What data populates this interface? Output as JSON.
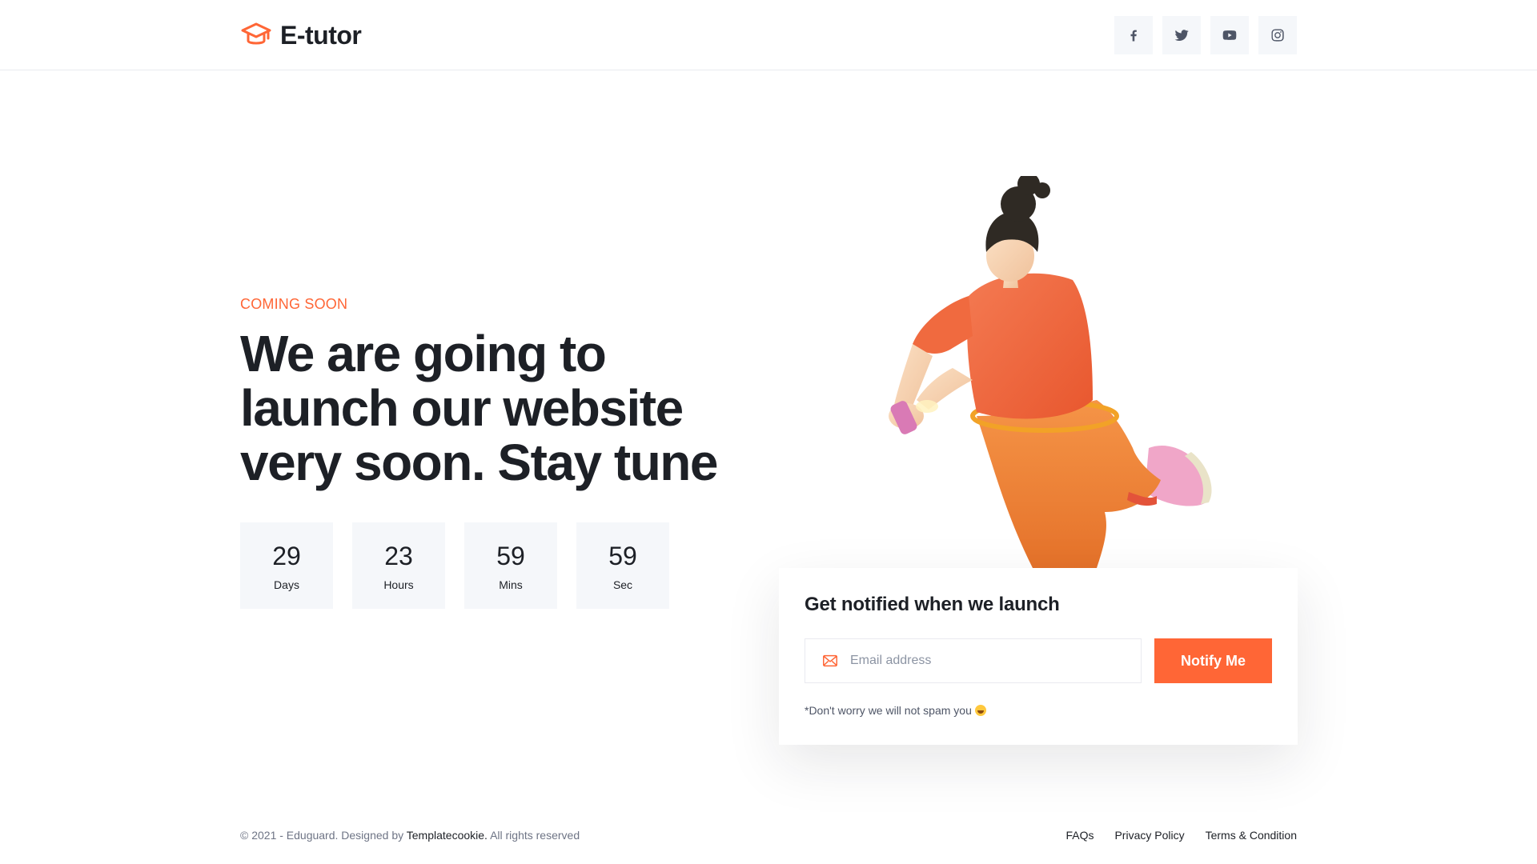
{
  "brand": {
    "name": "E-tutor",
    "accent": "#ff6636"
  },
  "header": {
    "socials": [
      {
        "name": "facebook-icon"
      },
      {
        "name": "twitter-icon"
      },
      {
        "name": "youtube-icon"
      },
      {
        "name": "instagram-icon"
      }
    ]
  },
  "hero": {
    "eyebrow": "COMING SOON",
    "headline": [
      "We are going to",
      "launch our website",
      "very soon. Stay tune"
    ]
  },
  "countdown": [
    {
      "value": "29",
      "label": "Days"
    },
    {
      "value": "23",
      "label": "Hours"
    },
    {
      "value": "59",
      "label": "Mins"
    },
    {
      "value": "59",
      "label": "Sec"
    }
  ],
  "notify": {
    "title": "Get notified when we launch",
    "email_placeholder": "Email address",
    "button_label": "Notify Me",
    "disclaimer": "*Don't worry we will not spam you"
  },
  "footer": {
    "copyright_prefix": "© 2021 - Eduguard. Designed by",
    "designer": "Templatecookie.",
    "copyright_suffix": "All rights reserved",
    "links": [
      "FAQs",
      "Privacy Policy",
      "Terms & Condition"
    ]
  }
}
